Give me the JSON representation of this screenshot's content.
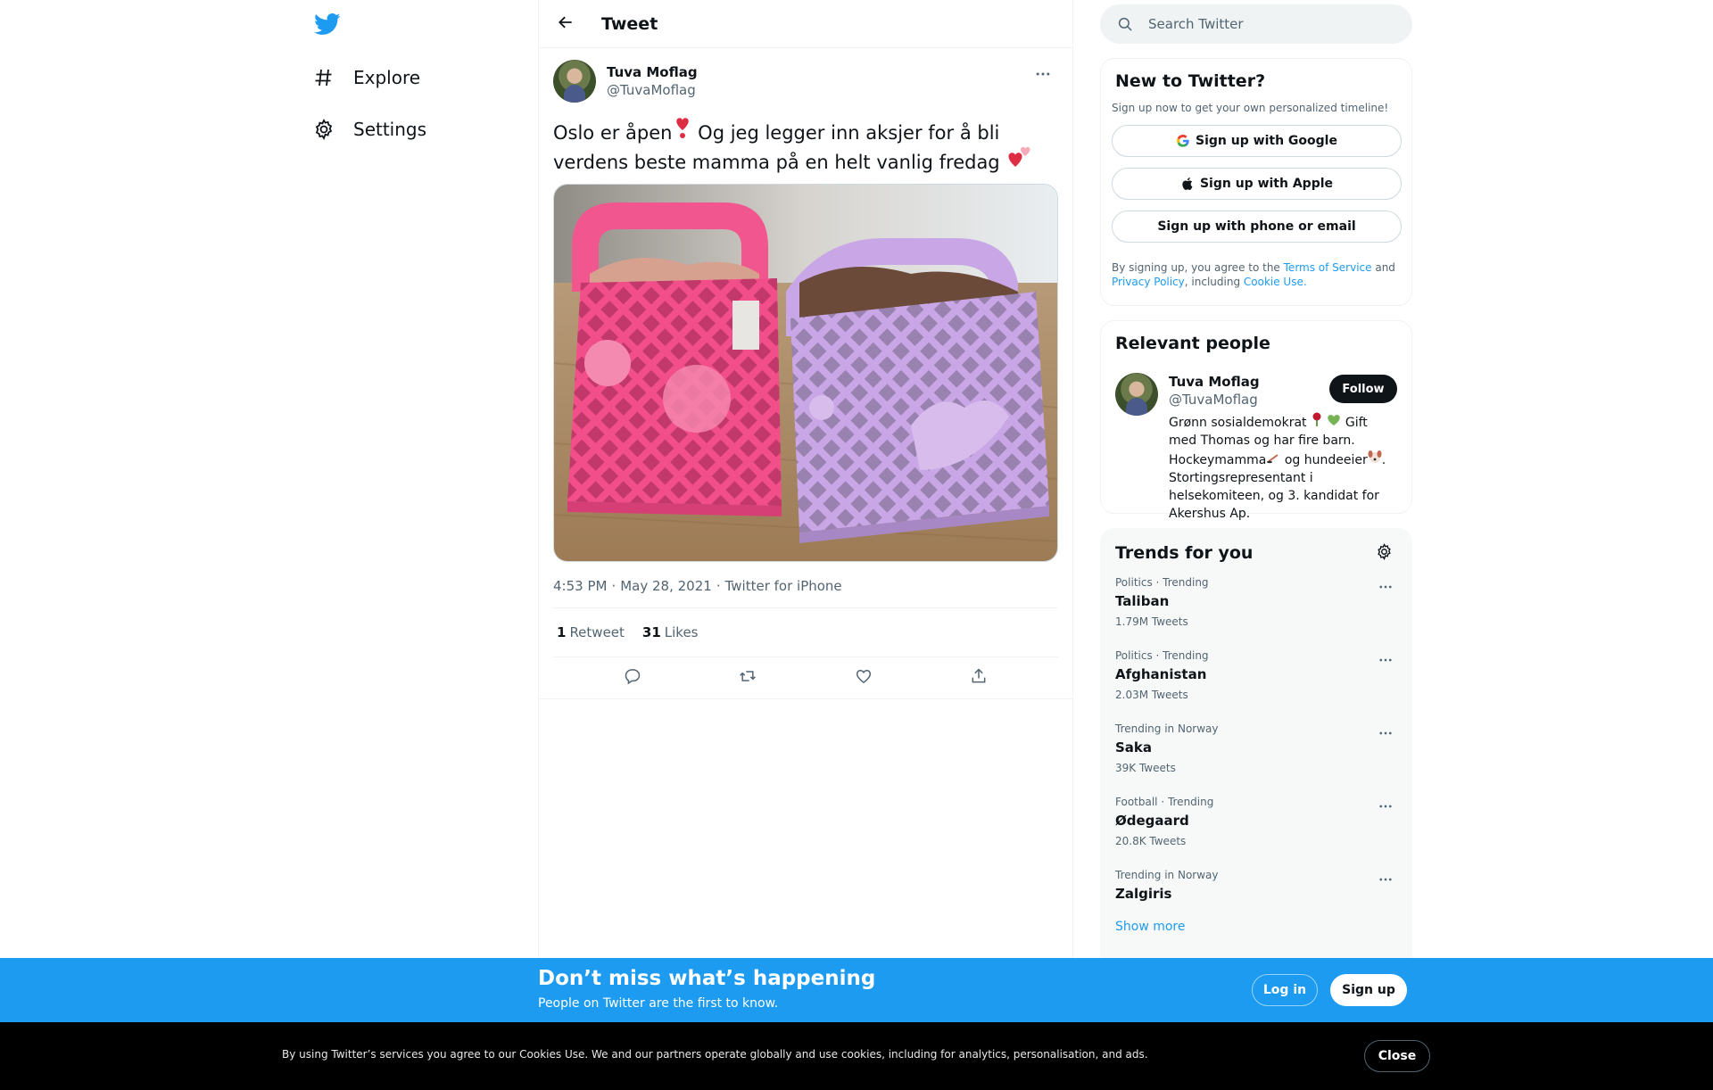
{
  "nav": {
    "logo_icon": "twitter-bird-icon",
    "items": [
      {
        "label": "Explore",
        "icon": "hashtag-icon"
      },
      {
        "label": "Settings",
        "icon": "gear-icon"
      }
    ]
  },
  "main": {
    "title": "Tweet",
    "back_icon": "arrow-left-icon"
  },
  "tweet": {
    "author_name": "Tuva Moflag",
    "author_handle": "@TuvaMoflag",
    "text_part1": "Oslo er åpen",
    "text_part2": " Og jeg legger inn aksjer for å bli verdens beste mamma på en helt vanlig fredag ",
    "time": "4:53 PM",
    "date": "May 28, 2021",
    "source": "Twitter for iPhone",
    "retweets_count": "1",
    "retweets_label": "Retweet",
    "likes_count": "31",
    "likes_label": "Likes"
  },
  "search": {
    "placeholder": "Search Twitter"
  },
  "signup_panel": {
    "title": "New to Twitter?",
    "subtitle": "Sign up now to get your own personalized timeline!",
    "google_label": "Sign up with Google",
    "apple_label": "Sign up with Apple",
    "phone_label": "Sign up with phone or email",
    "legal_prefix": "By signing up, you agree to the ",
    "terms_link": "Terms of Service",
    "legal_and": " and ",
    "privacy_link": "Privacy Policy",
    "legal_including": ", including ",
    "cookie_link": "Cookie Use."
  },
  "people_panel": {
    "title": "Relevant people",
    "name": "Tuva Moflag",
    "handle": "@TuvaMoflag",
    "follow_label": "Follow",
    "bio_1": "Grønn sosialdemokrat ",
    "bio_2": " Gift med Thomas og har fire barn. Hockeymamma",
    "bio_3": " og hundeeier",
    "bio_4": ". Stortingsrepresentant i helsekomiteen, og 3. kandidat for Akershus Ap."
  },
  "trends_panel": {
    "title": "Trends for you",
    "trends": [
      {
        "category": "Politics · Trending",
        "name": "Taliban",
        "count": "1.79M Tweets"
      },
      {
        "category": "Politics · Trending",
        "name": "Afghanistan",
        "count": "2.03M Tweets"
      },
      {
        "category": "Trending in Norway",
        "name": "Saka",
        "count": "39K Tweets"
      },
      {
        "category": "Football · Trending",
        "name": "Ødegaard",
        "count": "20.8K Tweets"
      },
      {
        "category": "Trending in Norway",
        "name": "Zalgiris",
        "count": ""
      }
    ],
    "show_more": "Show more"
  },
  "promo": {
    "title": "Don’t miss what’s happening",
    "subtitle": "People on Twitter are the first to know.",
    "login_label": "Log in",
    "signup_label": "Sign up"
  },
  "cookie": {
    "text": "By using Twitter’s services you agree to our Cookies Use. We and our partners operate globally and use cookies, including for analytics, personalisation, and ads.",
    "close_label": "Close"
  },
  "colors": {
    "brand": "#1d9bf0",
    "text": "#0f1419",
    "muted": "#536471"
  }
}
